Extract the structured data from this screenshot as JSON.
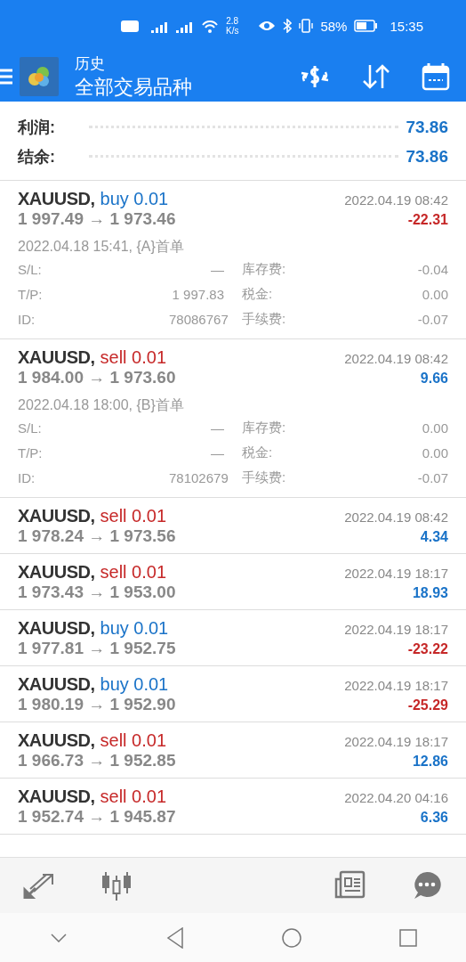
{
  "status_bar": {
    "network_speed": "2.8\nK/s",
    "battery": "58%",
    "time": "15:35"
  },
  "app_bar": {
    "title": "历史",
    "subtitle": "全部交易品种"
  },
  "summary": [
    {
      "label": "利润:",
      "value": "73.86"
    },
    {
      "label": "结余:",
      "value": "73.86"
    }
  ],
  "trades": [
    {
      "symbol": "XAUUSD,",
      "deal": {
        "text": "buy 0.01",
        "color": "#1a73c8"
      },
      "prices": "1 997.49 → 1 973.46",
      "time": "2022.04.19 08:42",
      "profit": {
        "text": "-22.31",
        "color": "#c62828"
      },
      "expanded": true,
      "opened": "2022.04.18 15:41, {A}首单",
      "details": [
        {
          "label": "S/L:",
          "value": "—",
          "label2": "库存费:",
          "value2": "-0.04"
        },
        {
          "label": "T/P:",
          "value": "1 997.83",
          "label2": "税金:",
          "value2": "0.00"
        },
        {
          "label": "ID:",
          "value": "78086767",
          "label2": "手续费:",
          "value2": "-0.07"
        }
      ]
    },
    {
      "symbol": "XAUUSD,",
      "deal": {
        "text": "sell 0.01",
        "color": "#c62828"
      },
      "prices": "1 984.00 → 1 973.60",
      "time": "2022.04.19 08:42",
      "profit": {
        "text": "9.66",
        "color": "#1a73c8"
      },
      "expanded": true,
      "opened": "2022.04.18 18:00, {B}首单",
      "details": [
        {
          "label": "S/L:",
          "value": "—",
          "label2": "库存费:",
          "value2": "0.00"
        },
        {
          "label": "T/P:",
          "value": "—",
          "label2": "税金:",
          "value2": "0.00"
        },
        {
          "label": "ID:",
          "value": "78102679",
          "label2": "手续费:",
          "value2": "-0.07"
        }
      ]
    },
    {
      "symbol": "XAUUSD,",
      "deal": {
        "text": "sell 0.01",
        "color": "#c62828"
      },
      "prices": "1 978.24 → 1 973.56",
      "time": "2022.04.19 08:42",
      "profit": {
        "text": "4.34",
        "color": "#1a73c8"
      },
      "expanded": false
    },
    {
      "symbol": "XAUUSD,",
      "deal": {
        "text": "sell 0.01",
        "color": "#c62828"
      },
      "prices": "1 973.43 → 1 953.00",
      "time": "2022.04.19 18:17",
      "profit": {
        "text": "18.93",
        "color": "#1a73c8"
      },
      "expanded": false
    },
    {
      "symbol": "XAUUSD,",
      "deal": {
        "text": "buy 0.01",
        "color": "#1a73c8"
      },
      "prices": "1 977.81 → 1 952.75",
      "time": "2022.04.19 18:17",
      "profit": {
        "text": "-23.22",
        "color": "#c62828"
      },
      "expanded": false
    },
    {
      "symbol": "XAUUSD,",
      "deal": {
        "text": "buy 0.01",
        "color": "#1a73c8"
      },
      "prices": "1 980.19 → 1 952.90",
      "time": "2022.04.19 18:17",
      "profit": {
        "text": "-25.29",
        "color": "#c62828"
      },
      "expanded": false
    },
    {
      "symbol": "XAUUSD,",
      "deal": {
        "text": "sell 0.01",
        "color": "#c62828"
      },
      "prices": "1 966.73 → 1 952.85",
      "time": "2022.04.19 18:17",
      "profit": {
        "text": "12.86",
        "color": "#1a73c8"
      },
      "expanded": false
    },
    {
      "symbol": "XAUUSD,",
      "deal": {
        "text": "sell 0.01",
        "color": "#c62828"
      },
      "prices": "1 952.74 → 1 945.87",
      "time": "2022.04.20 04:16",
      "profit": {
        "text": "6.36",
        "color": "#1a73c8"
      },
      "expanded": false
    }
  ]
}
